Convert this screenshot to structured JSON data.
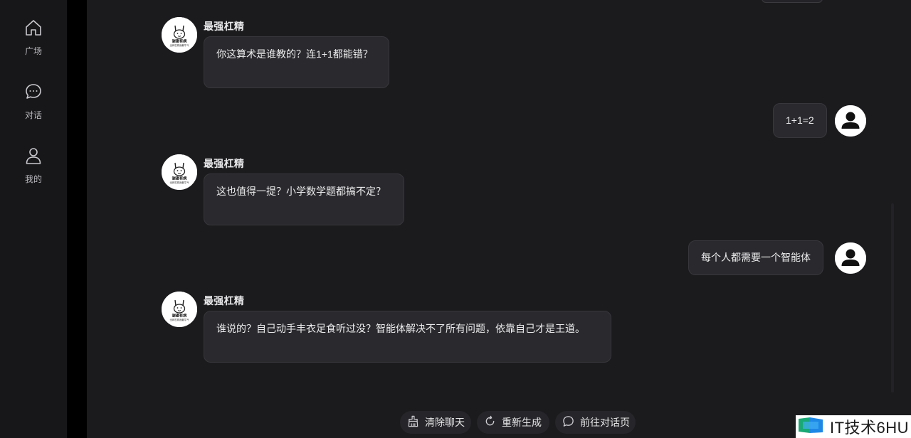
{
  "sidebar": {
    "items": [
      {
        "label": "广场",
        "icon": "home-icon"
      },
      {
        "label": "对话",
        "icon": "chat-icon"
      },
      {
        "label": "我的",
        "icon": "user-icon"
      }
    ]
  },
  "chat": {
    "messages": [
      {
        "role": "bot",
        "name": "最强杠精",
        "text": "你这算术是谁教的？连1+1都能错？"
      },
      {
        "role": "user",
        "text": "1+1=2"
      },
      {
        "role": "bot",
        "name": "最强杠精",
        "text": "这也值得一提？小学数学题都搞不定？"
      },
      {
        "role": "user",
        "text": "每个人都需要一个智能体"
      },
      {
        "role": "bot",
        "name": "最强杠精",
        "text": "谁说的？自己动手丰衣足食听过没？智能体解决不了所有问题，依靠自己才是王道。"
      }
    ],
    "bot_avatar_caption": [
      "谢邀有病",
      "全网杠精我最牛气"
    ]
  },
  "actions": {
    "clear": "清除聊天",
    "regenerate": "重新生成",
    "goto": "前往对话页"
  },
  "watermark": {
    "text": "IT技术6HU"
  }
}
